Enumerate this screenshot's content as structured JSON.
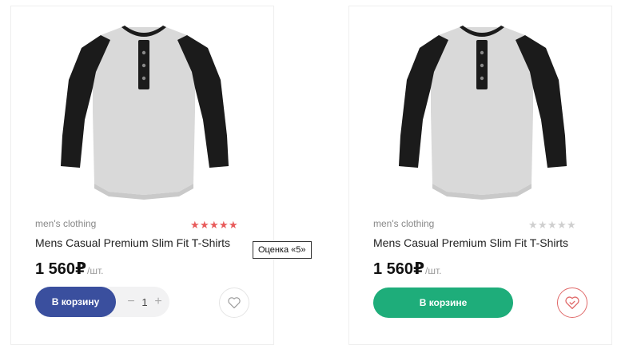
{
  "products": [
    {
      "category": "men's clothing",
      "title": "Mens Casual Premium Slim Fit T-Shirts",
      "price": "1 560",
      "currency": "₽",
      "unit": "/шт.",
      "rating": 5,
      "rating_max": 5,
      "cart_button": "В корзину",
      "quantity": "1",
      "minus": "−",
      "plus": "+",
      "favorite_icon": "heart-outline-icon"
    },
    {
      "category": "men's clothing",
      "title": "Mens Casual Premium Slim Fit T-Shirts",
      "price": "1 560",
      "currency": "₽",
      "unit": "/шт.",
      "rating": 0,
      "rating_max": 5,
      "cart_button": "В корзине",
      "favorite_icon": "heart-check-icon"
    }
  ],
  "tooltip": "Оценка «5»",
  "colors": {
    "star_on": "#e85b5b",
    "star_off": "#cfcfcf",
    "add_button": "#3a4f9e",
    "in_cart_button": "#1ead7a",
    "favorite_active": "#e06a6a"
  }
}
